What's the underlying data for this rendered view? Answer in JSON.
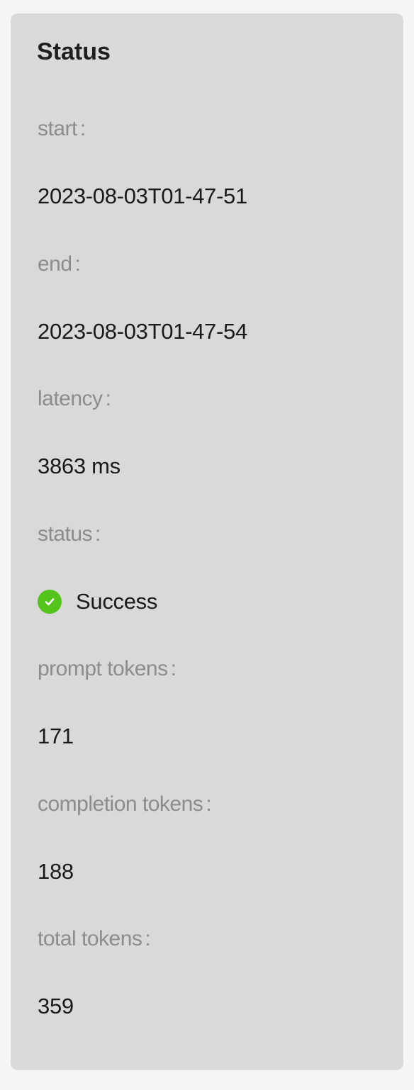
{
  "panel": {
    "title": "Status"
  },
  "fields": [
    {
      "label": "start",
      "value": "2023-08-03T01-47-51"
    },
    {
      "label": "end",
      "value": "2023-08-03T01-47-54"
    },
    {
      "label": "latency",
      "value": "3863 ms"
    },
    {
      "label": "status",
      "value": "Success",
      "icon": "check-circle-icon",
      "icon_color": "#52c41a"
    },
    {
      "label": "prompt tokens",
      "value": "171"
    },
    {
      "label": "completion tokens",
      "value": "188"
    },
    {
      "label": "total tokens",
      "value": "359"
    }
  ],
  "separator": ":"
}
